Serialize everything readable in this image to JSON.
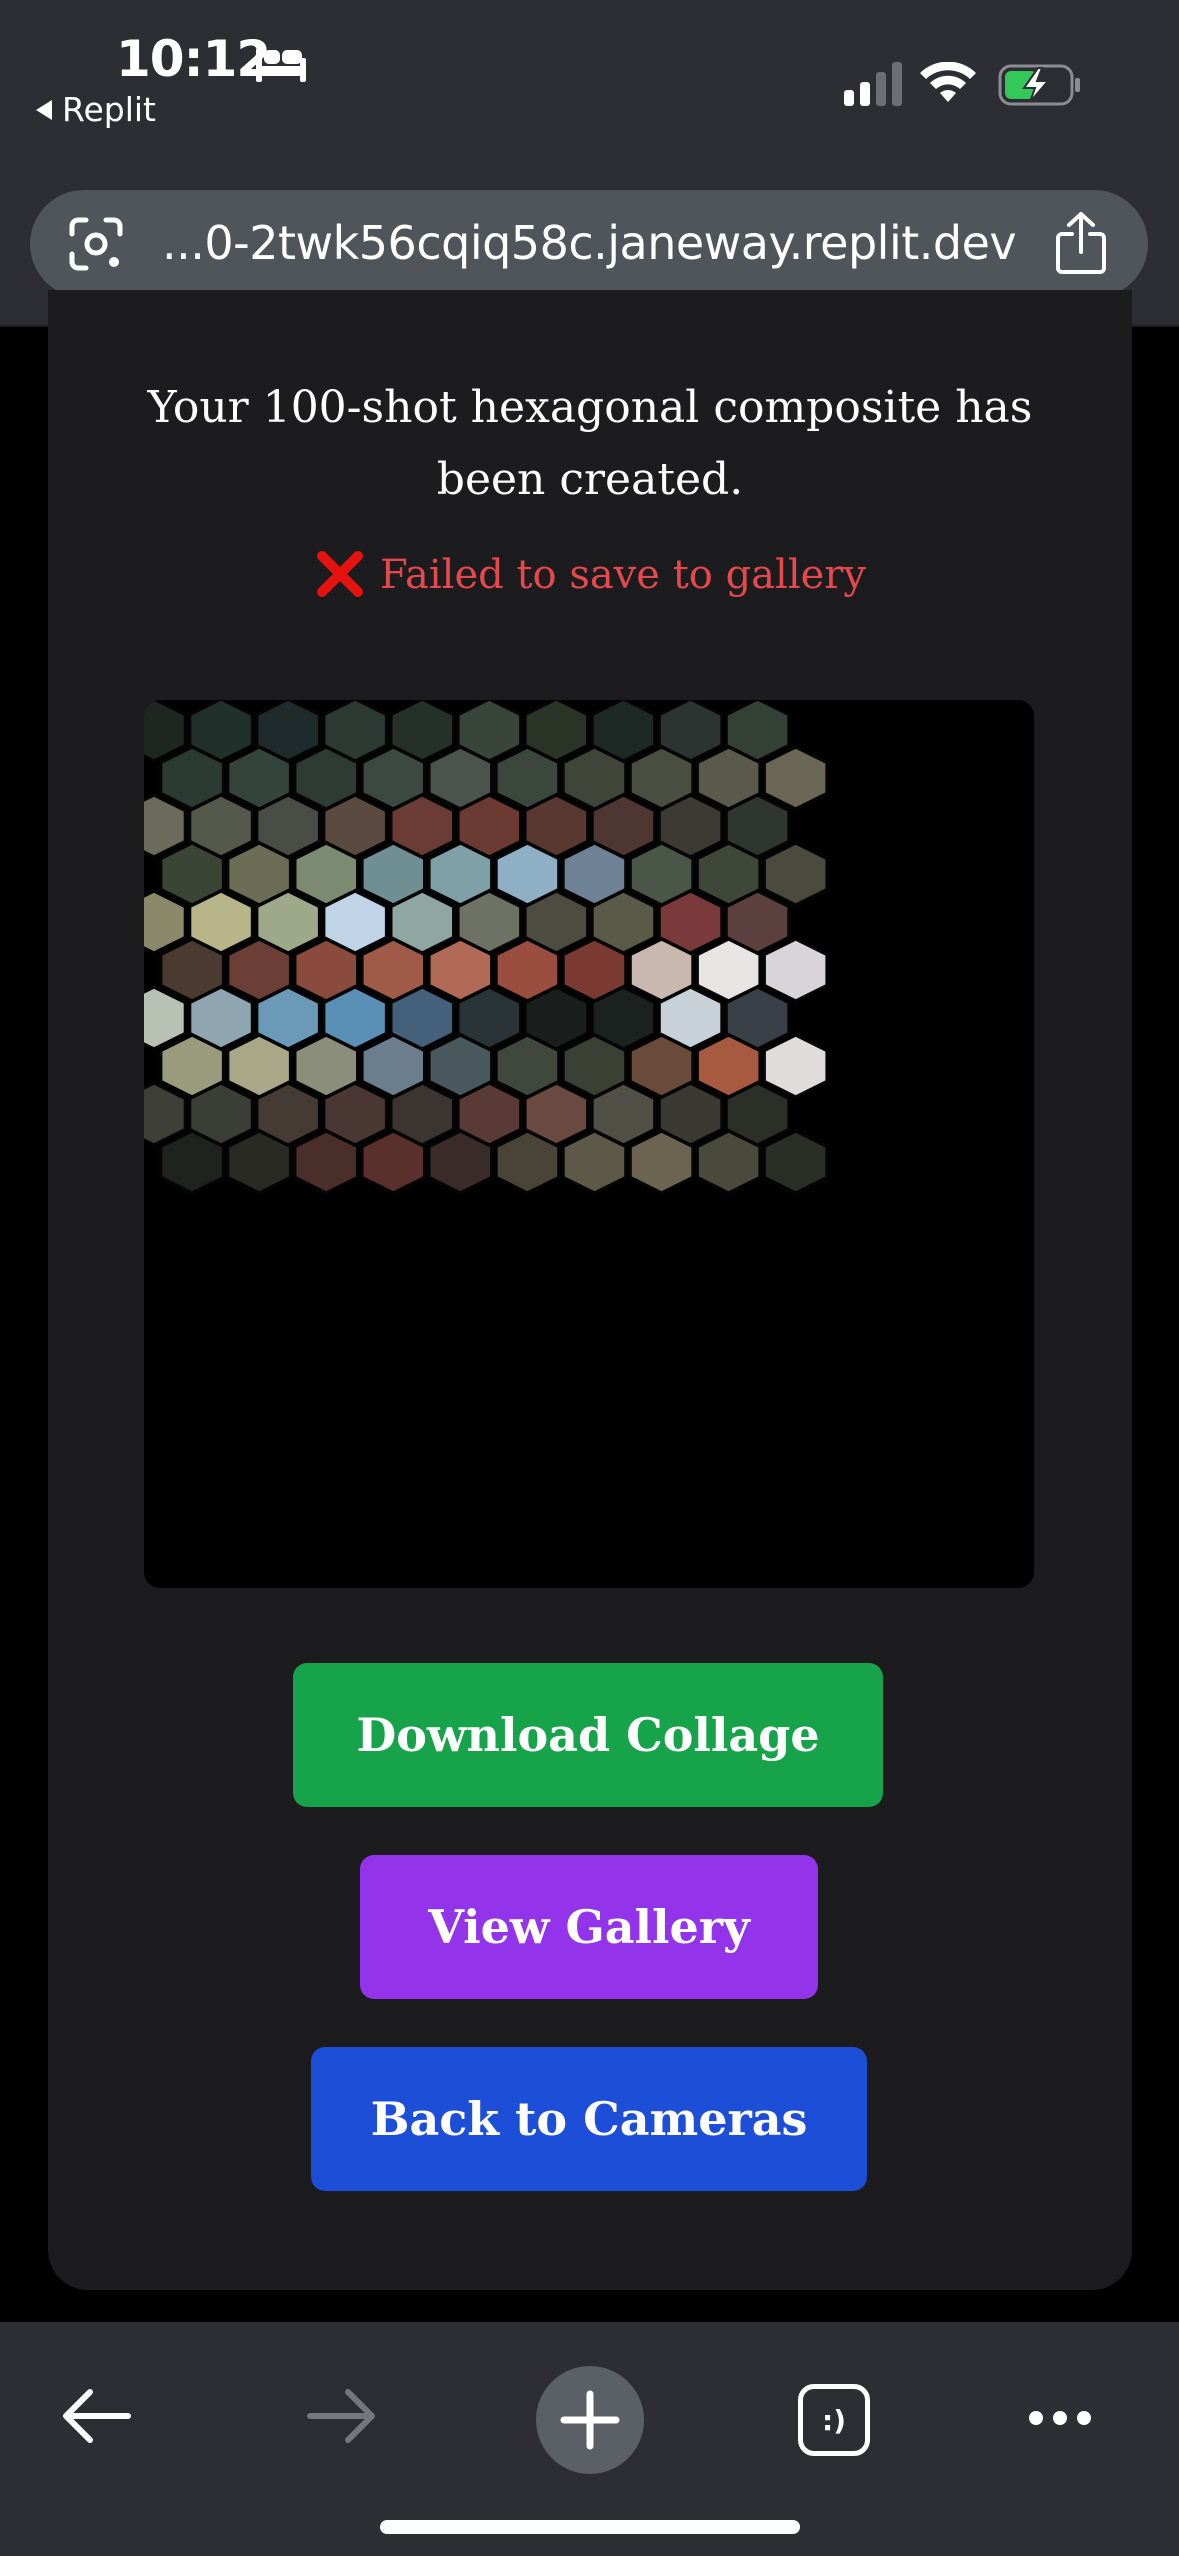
{
  "status_bar": {
    "time": "10:12",
    "back_app_label": "Replit",
    "icons": [
      "bed-icon",
      "cellular-signal-icon",
      "wifi-icon",
      "battery-charging-icon"
    ],
    "signal_bars_active": 2,
    "signal_bars_total": 4,
    "battery_level": 0.45
  },
  "browser": {
    "url": "...0-2twk56cqiq58c.janeway.replit.dev",
    "left_icon": "google-lens-icon",
    "right_icon": "share-icon"
  },
  "result": {
    "headline": "Your 100-shot hexagonal composite has been created.",
    "error_message": "Failed to save to gallery",
    "error_color": "#e5484d"
  },
  "actions": {
    "download_label": "Download Collage",
    "gallery_label": "View Gallery",
    "back_label": "Back to Cameras",
    "download_color": "#16a34a",
    "gallery_color": "#9333ea",
    "back_color": "#1d4ed8"
  },
  "toolbar": {
    "items": [
      "back-arrow-icon",
      "forward-arrow-icon",
      "new-tab-plus-icon",
      "tab-switcher-icon",
      "more-menu-icon"
    ],
    "tab_switcher_glyph": ":)"
  }
}
